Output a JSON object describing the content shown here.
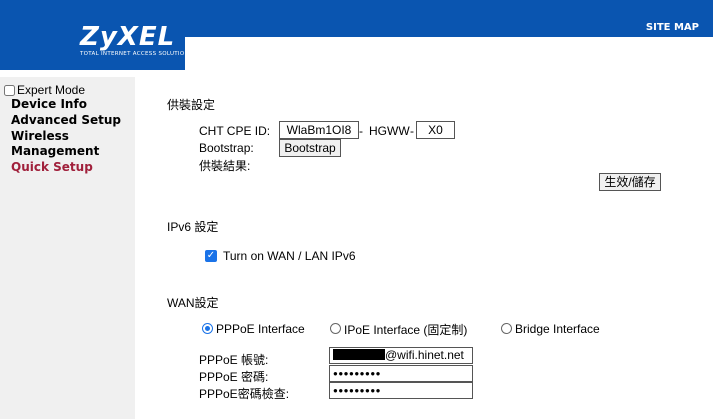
{
  "header": {
    "logo": "ZyXEL",
    "logo_sub": "TOTAL INTERNET ACCESS SOLUTION",
    "site_map": "SITE MAP"
  },
  "sidebar": {
    "expert_mode": "Expert Mode",
    "items": [
      {
        "label": "Device Info"
      },
      {
        "label": "Advanced Setup"
      },
      {
        "label": "Wireless"
      },
      {
        "label": "Management"
      },
      {
        "label": "Quick Setup"
      }
    ]
  },
  "provision": {
    "title": "供裝設定",
    "cpe_label": "CHT CPE ID:",
    "cpe_value": "WlaBm1OI8",
    "dash1": "-",
    "hgww": "HGWW",
    "dash2": "-",
    "suffix": "X0",
    "bootstrap_label": "Bootstrap:",
    "bootstrap_button": "Bootstrap",
    "result_label": "供裝結果:",
    "save_button": "生效/儲存"
  },
  "ipv6": {
    "title": "IPv6 設定",
    "checkbox_label": "Turn on WAN / LAN IPv6"
  },
  "wan": {
    "title": "WAN設定",
    "options": [
      {
        "label": "PPPoE Interface"
      },
      {
        "label": "IPoE Interface (固定制)"
      },
      {
        "label": "Bridge Interface"
      }
    ],
    "account_label": "PPPoE 帳號:",
    "account_value": "@wifi.hinet.net",
    "password_label": "PPPoE 密碼:",
    "password_value": "●●●●●●●●●",
    "confirm_label": "PPPoE密碼檢查:",
    "confirm_value": "●●●●●●●●●"
  },
  "colors": {
    "brand_blue": "#0a55b0",
    "active_nav": "#a0203b",
    "accent": "#1a73e8"
  }
}
